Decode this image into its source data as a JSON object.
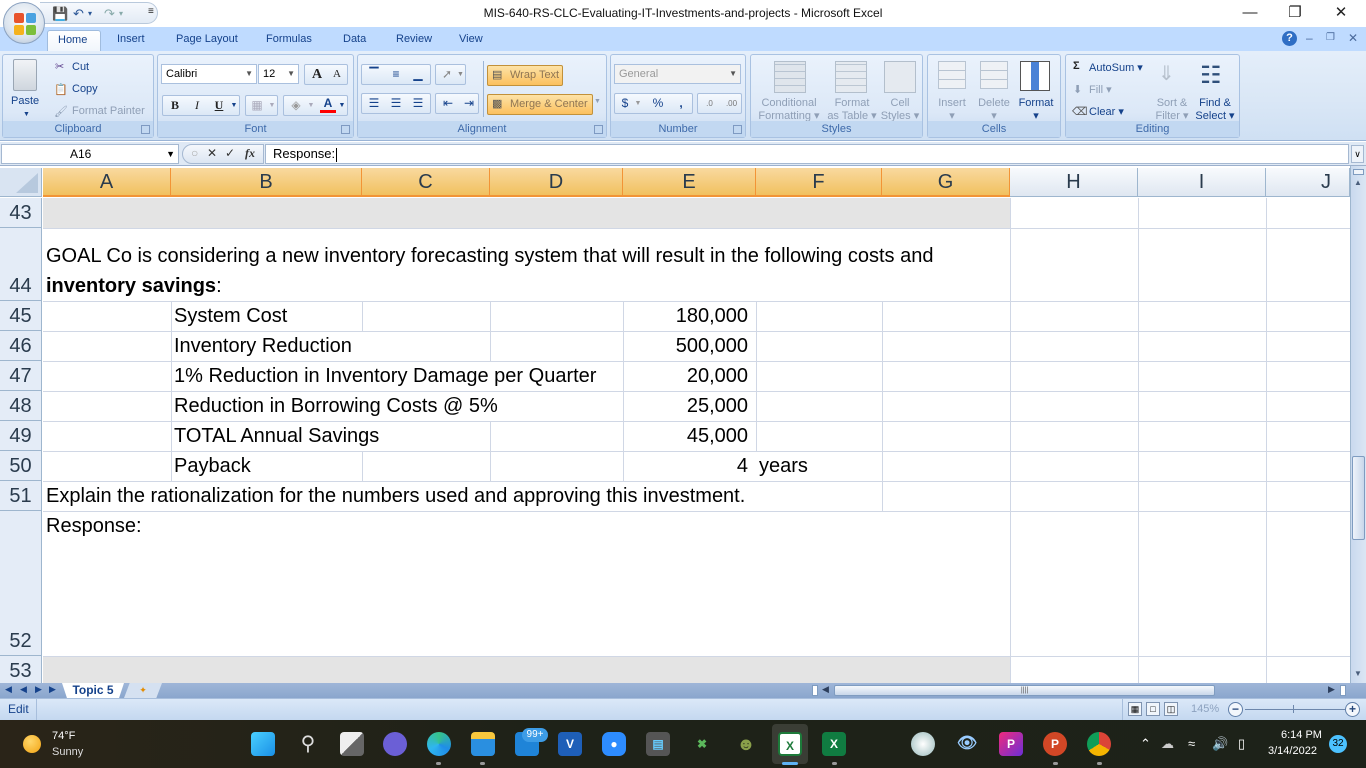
{
  "window": {
    "title": "MIS-640-RS-CLC-Evaluating-IT-Investments-and-projects - Microsoft Excel",
    "controls": [
      "minimize",
      "restore",
      "close"
    ]
  },
  "quick_access": [
    "save-icon",
    "undo-icon",
    "redo-icon",
    "customize-icon"
  ],
  "ribbon": {
    "tabs": [
      {
        "label": "Home",
        "active": true
      },
      {
        "label": "Insert"
      },
      {
        "label": "Page Layout"
      },
      {
        "label": "Formulas"
      },
      {
        "label": "Data"
      },
      {
        "label": "Review"
      },
      {
        "label": "View"
      }
    ],
    "groups": {
      "clipboard": {
        "label": "Clipboard",
        "paste": "Paste",
        "cut": "Cut",
        "copy": "Copy",
        "format_painter": "Format Painter"
      },
      "font": {
        "label": "Font",
        "font_name": "Calibri",
        "font_size": "12",
        "bold": "B",
        "italic": "I",
        "underline": "U",
        "grow": "A",
        "shrink": "A",
        "font_color": "#ff0000"
      },
      "alignment": {
        "label": "Alignment",
        "wrap_text": "Wrap Text",
        "merge_center": "Merge & Center"
      },
      "number": {
        "label": "Number",
        "format": "General",
        "currency": "$",
        "percent": "%",
        "comma": ",",
        "inc_decimal": ".00",
        "dec_decimal": ".0"
      },
      "styles": {
        "label": "Styles",
        "conditional": [
          "Conditional",
          "Formatting"
        ],
        "format_table": [
          "Format",
          "as Table"
        ],
        "cell_styles": [
          "Cell",
          "Styles"
        ]
      },
      "cells": {
        "label": "Cells",
        "insert": "Insert",
        "delete": "Delete",
        "format": "Format"
      },
      "editing": {
        "label": "Editing",
        "autosum": "AutoSum",
        "fill": "Fill",
        "clear": "Clear",
        "sort_filter": [
          "Sort &",
          "Filter"
        ],
        "find_select": [
          "Find &",
          "Select"
        ]
      }
    }
  },
  "formula_bar": {
    "name_box": "A16",
    "fx": "fx",
    "content": "Response:"
  },
  "sheet": {
    "columns": [
      "A",
      "B",
      "C",
      "D",
      "E",
      "F",
      "G",
      "H",
      "I",
      "J"
    ],
    "selected_columns": [
      "A",
      "B",
      "C",
      "D",
      "E",
      "F",
      "G"
    ],
    "rows": [
      "43",
      "44",
      "45",
      "46",
      "47",
      "48",
      "49",
      "50",
      "51",
      "52",
      "53"
    ],
    "intro_line1": "GOAL Co is considering a new inventory forecasting system that will result in the following costs and",
    "intro_line2_bold": "inventory savings",
    "intro_line2_tail": ":",
    "items": [
      {
        "row": "45",
        "label": "System Cost",
        "value": "180,000"
      },
      {
        "row": "46",
        "label": "Inventory Reduction",
        "value": "500,000"
      },
      {
        "row": "47",
        "label": "1% Reduction in Inventory Damage per Quarter",
        "value": "20,000"
      },
      {
        "row": "48",
        "label": "Reduction in Borrowing Costs @ 5%",
        "value": "25,000"
      },
      {
        "row": "49",
        "label": "TOTAL Annual Savings",
        "value": "45,000"
      },
      {
        "row": "50",
        "label": "Payback",
        "value": "4",
        "unit": "years"
      }
    ],
    "question": "Explain the rationalization for the numbers used and approving this investment.",
    "response_label": "Response:"
  },
  "sheet_tabs": [
    {
      "label": "Topic 5",
      "active": true
    }
  ],
  "status": {
    "mode": "Edit",
    "zoom": "145%"
  },
  "taskbar": {
    "weather": {
      "temp": "74°F",
      "desc": "Sunny"
    },
    "mail_badge": "99+",
    "time": "6:14 PM",
    "date": "3/14/2022",
    "notifications": "32"
  }
}
